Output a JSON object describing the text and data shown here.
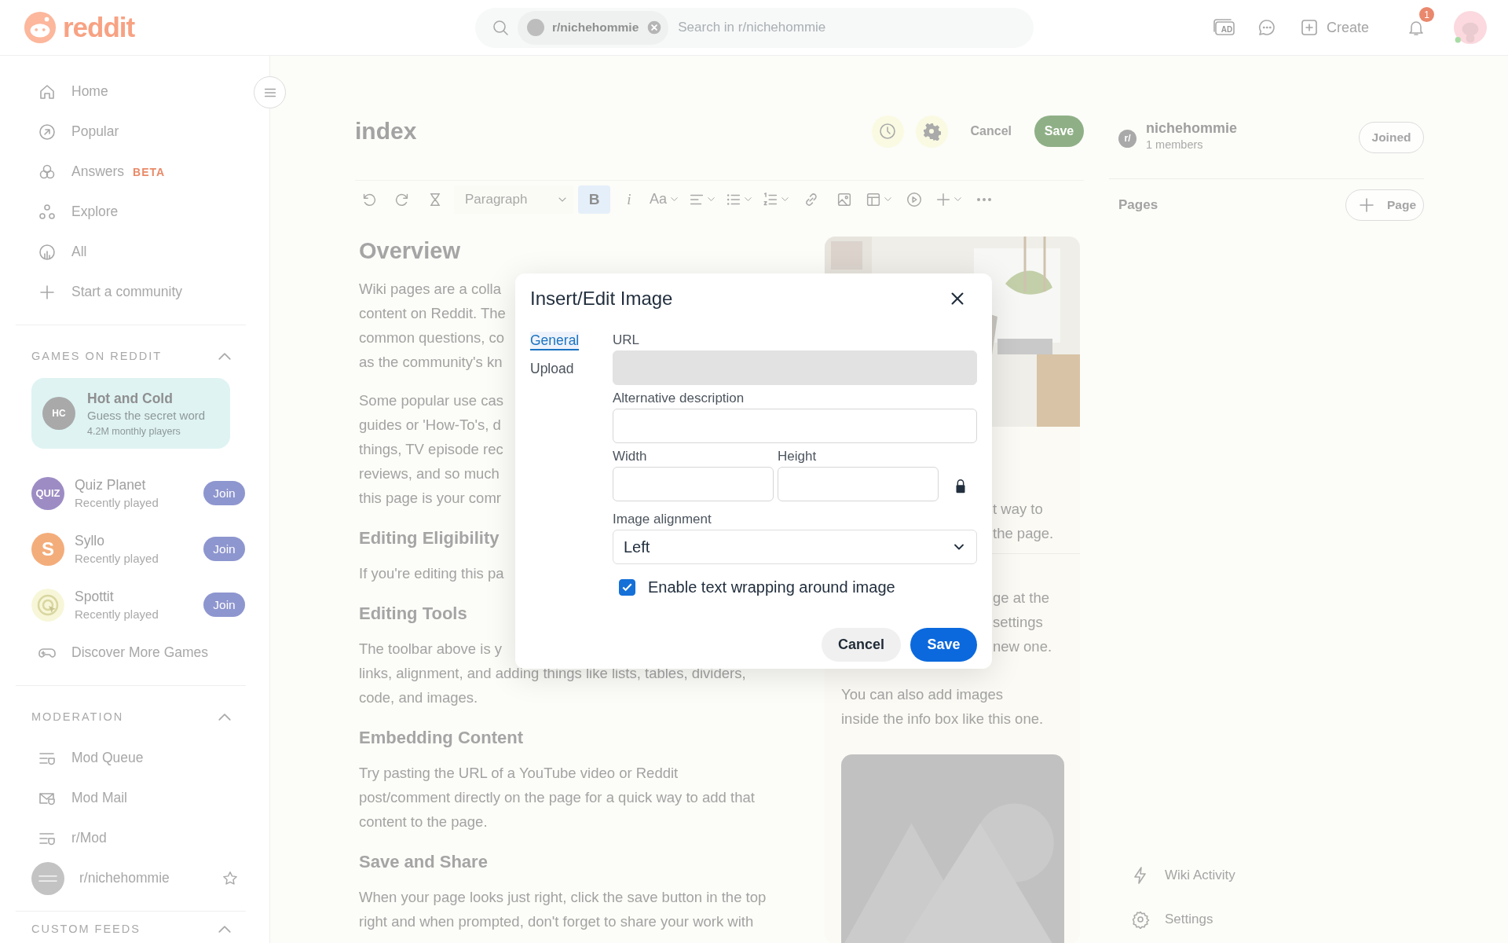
{
  "header": {
    "logo": "reddit",
    "search": {
      "chip": "r/nichehommie",
      "placeholder": "Search in r/nichehommie"
    },
    "ad_label": "AD",
    "create": "Create",
    "notification_count": "1"
  },
  "sidebar": {
    "nav": [
      {
        "label": "Home"
      },
      {
        "label": "Popular"
      },
      {
        "label": "Answers",
        "badge": "BETA"
      },
      {
        "label": "Explore"
      },
      {
        "label": "All"
      },
      {
        "label": "Start a community"
      }
    ],
    "games": {
      "title": "GAMES ON REDDIT",
      "expanded": true,
      "featured": {
        "avatar_text": "HC",
        "name": "Hot and Cold",
        "tagline": "Guess the secret word",
        "players": "4.2M monthly players"
      },
      "items": [
        {
          "avatar_text": "QUIZ",
          "name": "Quiz Planet",
          "status": "Recently played",
          "action": "Join"
        },
        {
          "avatar_text": "S",
          "name": "Syllo",
          "status": "Recently played",
          "action": "Join"
        },
        {
          "name": "Spottit",
          "status": "Recently played",
          "action": "Join"
        }
      ],
      "discover": "Discover More Games"
    },
    "moderation": {
      "title": "MODERATION",
      "expanded": true,
      "items": [
        {
          "kind": "tool",
          "label": "Mod Queue"
        },
        {
          "kind": "tool",
          "label": "Mod Mail"
        },
        {
          "kind": "tool",
          "label": "r/Mod"
        },
        {
          "kind": "community",
          "label": "r/nichehommie",
          "favorite": false
        }
      ]
    },
    "custom_feeds": {
      "title": "CUSTOM FEEDS",
      "expanded": true
    }
  },
  "editor": {
    "title": "index",
    "cancel": "Cancel",
    "save": "Save",
    "toolbar": {
      "format": "Paragraph",
      "bold": "B",
      "bold_on": true,
      "italic": "i",
      "font_size": "Aa"
    },
    "article": [
      {
        "kind": "title",
        "text": "Overview"
      },
      {
        "kind": "paragraph",
        "lines": [
          "Wiki pages are a colla",
          "content on Reddit. The",
          "common questions, co",
          "as the community's kn"
        ]
      },
      {
        "kind": "paragraph",
        "lines": [
          "Some popular use cas",
          "guides or 'How-To's, d",
          "things, TV episode rec",
          "reviews, and so much",
          "this page is your comr"
        ]
      },
      {
        "kind": "heading",
        "text": "Editing Eligibility"
      },
      {
        "kind": "paragraph",
        "lines": [
          "If you're editing this pa"
        ]
      },
      {
        "kind": "heading",
        "text": "Editing Tools"
      },
      {
        "kind": "paragraph",
        "lines": [
          "The toolbar above is y",
          "links, alignment, and adding things like lists, tables, dividers,",
          "code, and images."
        ]
      },
      {
        "kind": "heading",
        "text": "Embedding Content"
      },
      {
        "kind": "paragraph",
        "lines": [
          "Try pasting the URL of a YouTube video or Reddit",
          "post/comment directly on the page for a quick way to add that",
          "content to the page."
        ]
      },
      {
        "kind": "heading",
        "text": "Save and Share"
      },
      {
        "kind": "paragraph",
        "lines": [
          "When your page looks just right, click the save button in the top",
          "right and when prompted, don't forget to share your work with"
        ]
      }
    ],
    "infobox": {
      "blocks": [
        {
          "kind": "covered",
          "lines": [
            "t way to",
            "the page."
          ]
        },
        {
          "kind": "covered",
          "lines": [
            "ge at the",
            "settings",
            "new one."
          ]
        },
        {
          "kind": "plain",
          "lines": [
            "You can also add images",
            "inside the info box like this one."
          ]
        }
      ]
    }
  },
  "community": {
    "icon_text": "r/",
    "name": "nichehommie",
    "members": "1 members",
    "action": "Joined",
    "pages_title": "Pages",
    "add_page": "Page",
    "links": [
      {
        "label": "Wiki Activity"
      },
      {
        "label": "Settings"
      }
    ]
  },
  "dialog": {
    "title": "Insert/Edit Image",
    "tabs": [
      {
        "label": "General",
        "selected": true
      },
      {
        "label": "Upload",
        "selected": false
      }
    ],
    "fields": [
      {
        "label": "URL",
        "disabled": true
      },
      {
        "label": "Alternative description",
        "disabled": false
      }
    ],
    "size": {
      "width_label": "Width",
      "height_label": "Height",
      "locked": true
    },
    "alignment": {
      "label": "Image alignment",
      "value": "Left"
    },
    "wrap": {
      "label": "Enable text wrapping around image",
      "checked": true
    },
    "cancel": "Cancel",
    "save": "Save"
  }
}
